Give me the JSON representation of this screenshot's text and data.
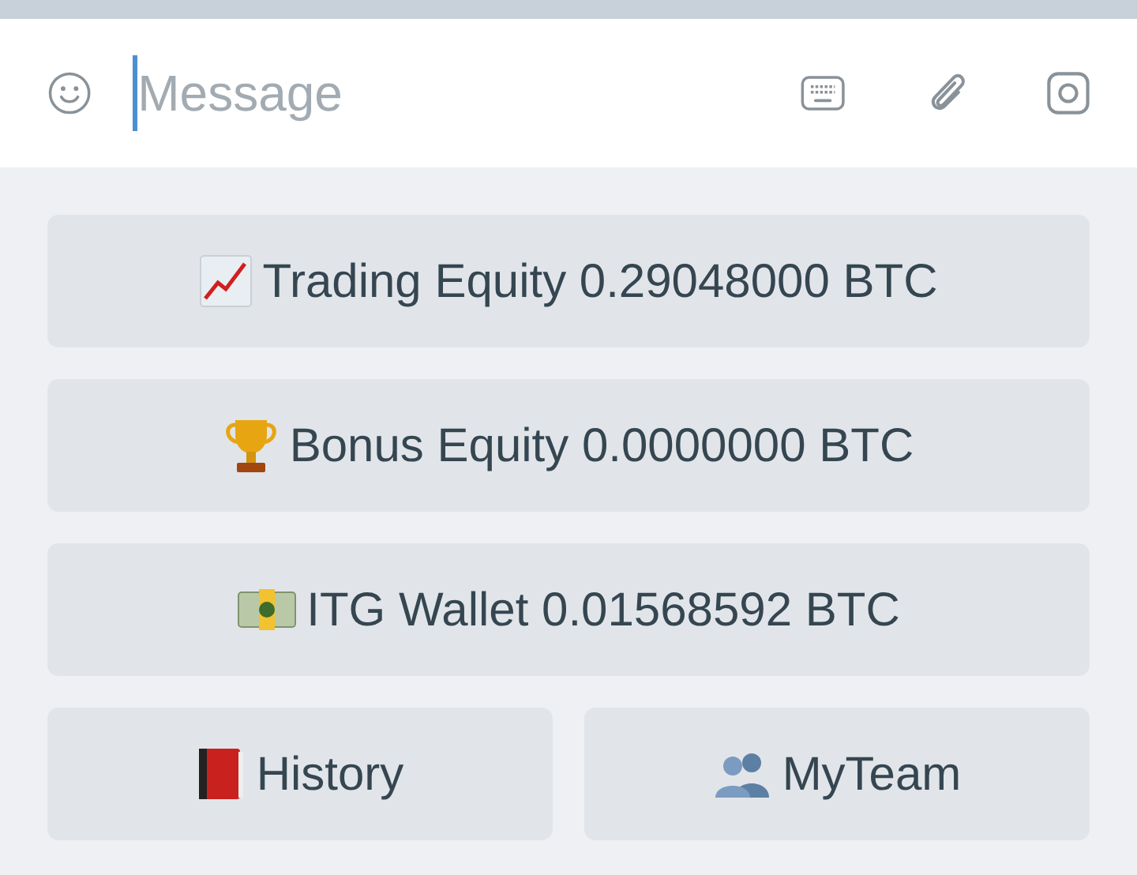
{
  "composer": {
    "placeholder": "Message"
  },
  "keyboard": {
    "rows": [
      [
        {
          "label": "Trading Equity 0.29048000 BTC"
        }
      ],
      [
        {
          "label": "Bonus Equity 0.0000000 BTC"
        }
      ],
      [
        {
          "label": "ITG Wallet 0.01568592 BTC"
        }
      ],
      [
        {
          "label": "History"
        },
        {
          "label": "MyTeam"
        }
      ]
    ]
  }
}
